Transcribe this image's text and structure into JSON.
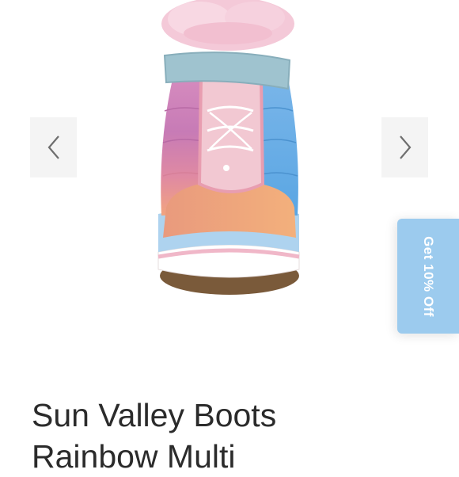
{
  "carousel": {
    "prev_icon": "chevron-left-icon",
    "next_icon": "chevron-right-icon",
    "button_bg": "#f4f4f4"
  },
  "product": {
    "title_line1": "Sun Valley Boots",
    "title_line2": "Rainbow Multi"
  },
  "promo": {
    "label": "Get 10% Off",
    "bg_color": "#9ccbee"
  }
}
